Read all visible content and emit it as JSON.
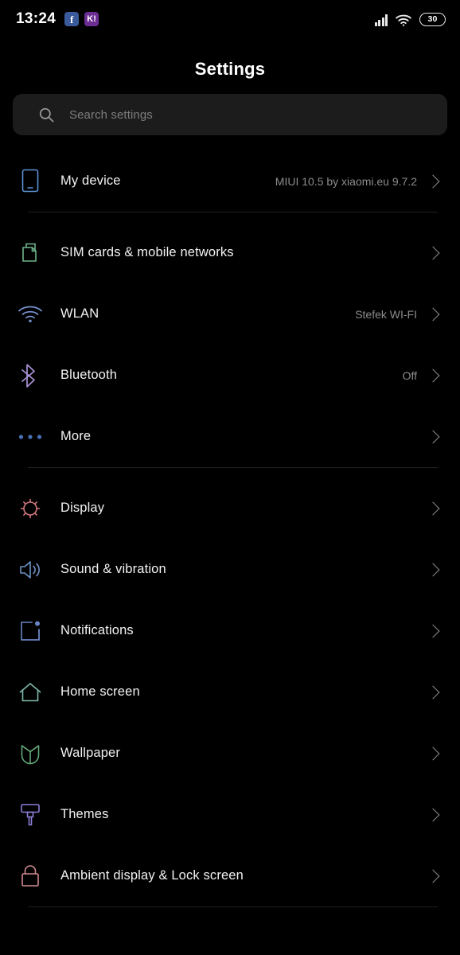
{
  "statusbar": {
    "time": "13:24",
    "notification_icons": [
      {
        "name": "facebook-icon",
        "glyph": "f",
        "color": "#3b5a9b"
      },
      {
        "name": "kahoot-icon",
        "glyph": "K!",
        "color": "#6b2d91"
      }
    ],
    "signal_icon": "cellular-signal-icon",
    "signal_bars": 4,
    "wifi_icon": "wifi-icon",
    "battery_level": "30"
  },
  "header": {
    "title": "Settings"
  },
  "search": {
    "placeholder": "Search settings",
    "icon": "search-icon"
  },
  "list": {
    "groups": [
      {
        "items": [
          {
            "label": "My device",
            "value": "MIUI 10.5 by xiaomi.eu 9.7.2",
            "icon": "phone-icon",
            "icon_color": "#5b93d6"
          }
        ]
      },
      {
        "items": [
          {
            "label": "SIM cards & mobile networks",
            "value": "",
            "icon": "sim-card-icon",
            "icon_color": "#6fb58a"
          },
          {
            "label": "WLAN",
            "value": "Stefek WI-FI",
            "icon": "wifi-icon",
            "icon_color": "#7b96d4"
          },
          {
            "label": "Bluetooth",
            "value": "Off",
            "icon": "bluetooth-icon",
            "icon_color": "#a992d6"
          },
          {
            "label": "More",
            "value": "",
            "icon": "more-dots-icon",
            "icon_color": "#4a6fb5"
          }
        ]
      },
      {
        "items": [
          {
            "label": "Display",
            "value": "",
            "icon": "brightness-icon",
            "icon_color": "#d1787f"
          },
          {
            "label": "Sound & vibration",
            "value": "",
            "icon": "speaker-icon",
            "icon_color": "#6d93c4"
          },
          {
            "label": "Notifications",
            "value": "",
            "icon": "notification-badge-icon",
            "icon_color": "#6b84c4"
          },
          {
            "label": "Home screen",
            "value": "",
            "icon": "home-icon",
            "icon_color": "#7fb9ab"
          },
          {
            "label": "Wallpaper",
            "value": "",
            "icon": "flower-icon",
            "icon_color": "#62a878"
          },
          {
            "label": "Themes",
            "value": "",
            "icon": "paintbrush-icon",
            "icon_color": "#8d7ed6"
          },
          {
            "label": "Ambient display & Lock screen",
            "value": "",
            "icon": "lock-icon",
            "icon_color": "#cf8a8f"
          }
        ]
      }
    ]
  },
  "chevron_icon": "chevron-right-icon"
}
